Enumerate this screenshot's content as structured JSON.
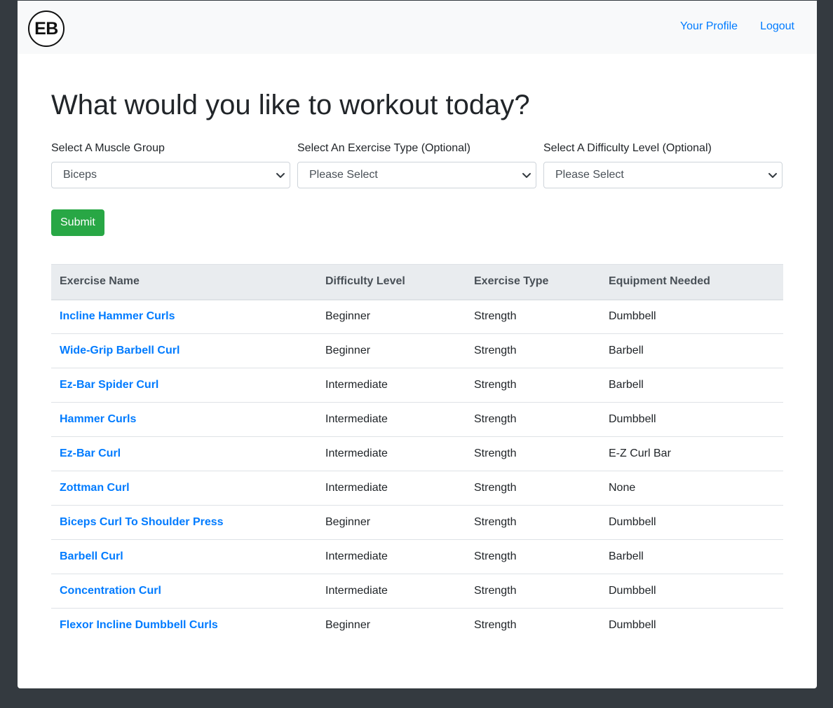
{
  "navbar": {
    "logo_text": "EB",
    "links": [
      "Your Profile",
      "Logout"
    ]
  },
  "main": {
    "heading": "What would you like to workout today?",
    "filters": [
      {
        "label": "Select A Muscle Group",
        "value": "Biceps"
      },
      {
        "label": "Select An Exercise Type (Optional)",
        "value": "Please Select"
      },
      {
        "label": "Select A Difficulty Level (Optional)",
        "value": "Please Select"
      }
    ],
    "submit_label": "Submit"
  },
  "table": {
    "headers": [
      "Exercise Name",
      "Difficulty Level",
      "Exercise Type",
      "Equipment Needed"
    ],
    "rows": [
      [
        "Incline Hammer Curls",
        "Beginner",
        "Strength",
        "Dumbbell"
      ],
      [
        "Wide-Grip Barbell Curl",
        "Beginner",
        "Strength",
        "Barbell"
      ],
      [
        "Ez-Bar Spider Curl",
        "Intermediate",
        "Strength",
        "Barbell"
      ],
      [
        "Hammer Curls",
        "Intermediate",
        "Strength",
        "Dumbbell"
      ],
      [
        "Ez-Bar Curl",
        "Intermediate",
        "Strength",
        "E-Z Curl Bar"
      ],
      [
        "Zottman Curl",
        "Intermediate",
        "Strength",
        "None"
      ],
      [
        "Biceps Curl To Shoulder Press",
        "Beginner",
        "Strength",
        "Dumbbell"
      ],
      [
        "Barbell Curl",
        "Intermediate",
        "Strength",
        "Barbell"
      ],
      [
        "Concentration Curl",
        "Intermediate",
        "Strength",
        "Dumbbell"
      ],
      [
        "Flexor Incline Dumbbell Curls",
        "Beginner",
        "Strength",
        "Dumbbell"
      ]
    ]
  },
  "colors": {
    "background": "#343a40",
    "link": "#007bff",
    "submit": "#28a745",
    "header_bg": "#e9ecef",
    "navbar_bg": "#f8f9fa"
  },
  "icons": {
    "select_arrow": "chevron-down-icon"
  }
}
